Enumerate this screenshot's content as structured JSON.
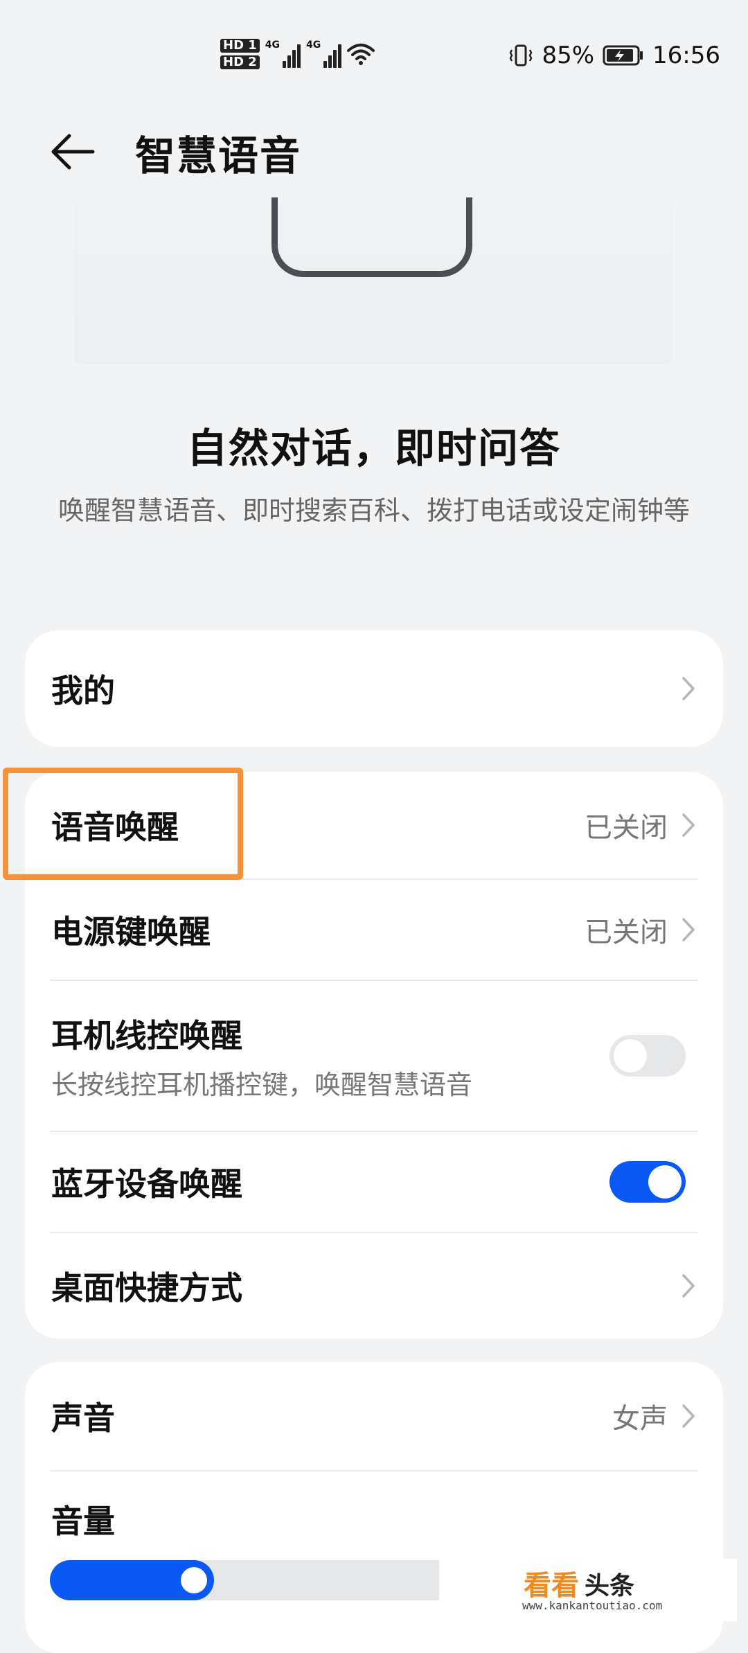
{
  "status_bar": {
    "hd1": "HD 1",
    "hd2": "HD 2",
    "net1": "4G",
    "net2": "4G",
    "battery": "85%",
    "time": "16:56"
  },
  "header": {
    "title": "智慧语音"
  },
  "hero": {
    "headline": "自然对话，即时问答",
    "description": "唤醒智慧语音、即时搜索百科、拨打电话或设定闹钟等"
  },
  "card_my": {
    "label": "我的"
  },
  "wake_card": {
    "voice_wake": {
      "label": "语音唤醒",
      "value": "已关闭"
    },
    "power_wake": {
      "label": "电源键唤醒",
      "value": "已关闭"
    },
    "earphone_wake": {
      "label": "耳机线控唤醒",
      "desc": "长按线控耳机播控键，唤醒智慧语音",
      "enabled": false
    },
    "bluetooth_wake": {
      "label": "蓝牙设备唤醒",
      "enabled": true
    },
    "desktop_shortcut": {
      "label": "桌面快捷方式"
    }
  },
  "sound_card": {
    "voice": {
      "label": "声音",
      "value": "女声"
    },
    "volume": {
      "label": "音量",
      "level": 0.42
    }
  },
  "watermark": {
    "main": "看看",
    "sub": "头条",
    "url": "www.kankantoutiao.com"
  },
  "colors": {
    "accent": "#0a59f7",
    "highlight": "#f7923a",
    "background": "#f1f3f5"
  }
}
